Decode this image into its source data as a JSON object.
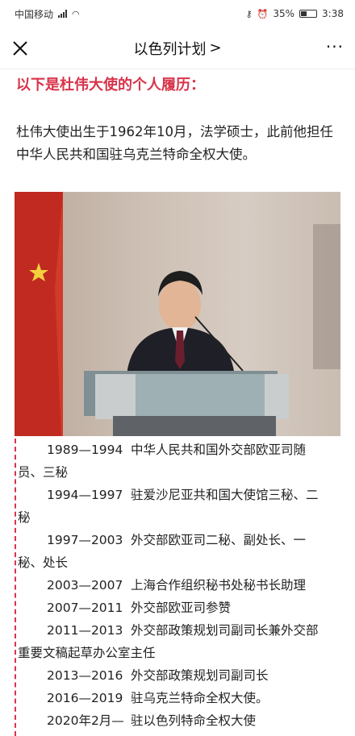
{
  "status_bar": {
    "carrier": "中国移动",
    "battery": "35%",
    "time": "3:38"
  },
  "nav": {
    "title": "以色列计划",
    "title_arrow": ">",
    "more": "···"
  },
  "article": {
    "heading": "以下是杜伟大使的个人履历：",
    "intro": "杜伟大使出生于1962年10月，法学硕士，此前他担任中华人民共和国驻乌克兰特命全权大使。",
    "resume": [
      {
        "years": "1989—1994",
        "text_first": "中华人民共和国外交部欧亚司随",
        "text_rest": "员、三秘"
      },
      {
        "years": "1994—1997",
        "text_first": "驻爱沙尼亚共和国大使馆三秘、二",
        "text_rest": "秘"
      },
      {
        "years": "1997—2003",
        "text_first": "外交部欧亚司二秘、副处长、一",
        "text_rest": "秘、处长"
      },
      {
        "years": "2003—2007",
        "text_first": "上海合作组织秘书处秘书长助理"
      },
      {
        "years": "2007—2011",
        "text_first": "外交部欧亚司参赞"
      },
      {
        "years": "2011—2013",
        "text_first": "外交部政策规划司副司长兼外交部",
        "text_rest": "重要文稿起草办公室主任"
      },
      {
        "years": "2013—2016",
        "text_first": "外交部政策规划司副司长"
      },
      {
        "years": "2016—2019",
        "text_first": "驻乌克兰特命全权大使。"
      },
      {
        "years": "2020年2月—",
        "text_first": "驻以色列特命全权大使"
      }
    ]
  }
}
